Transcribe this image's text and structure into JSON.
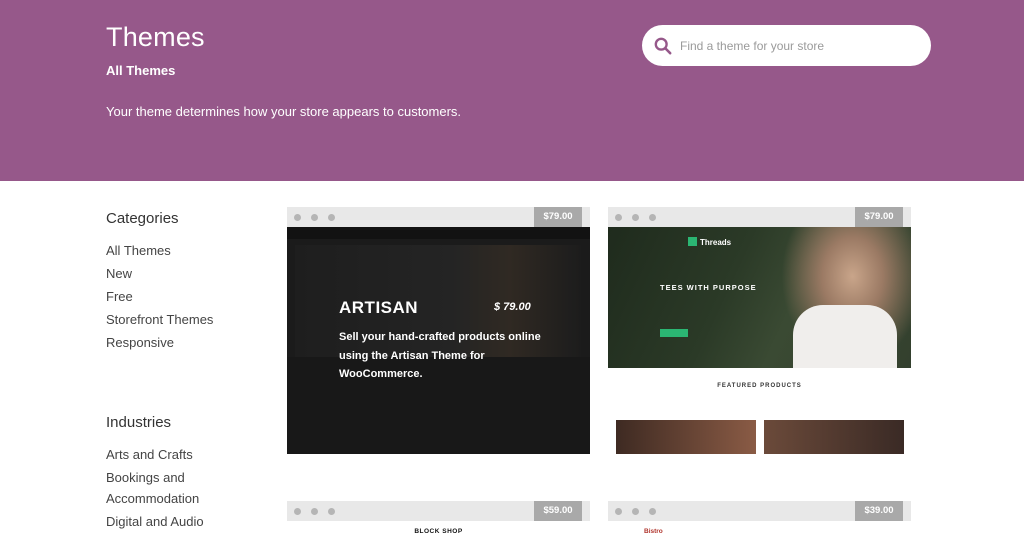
{
  "header": {
    "title": "Themes",
    "subtitle": "All Themes",
    "description": "Your theme determines how your store appears to customers.",
    "bg_color": "#96588a"
  },
  "search": {
    "placeholder": "Find a theme for your store",
    "icon": "search-icon"
  },
  "sidebar": {
    "categories_heading": "Categories",
    "categories": [
      "All Themes",
      "New",
      "Free",
      "Storefront Themes",
      "Responsive"
    ],
    "industries_heading": "Industries",
    "industries": [
      "Arts and Crafts",
      "Bookings and",
      "Accommodation",
      "Digital and Audio"
    ]
  },
  "themes": [
    {
      "price": "$79.00",
      "overlay_name": "ARTISAN",
      "overlay_price": "$ 79.00",
      "overlay_desc": "Sell your hand-crafted products online using the Artisan Theme for WooCommerce."
    },
    {
      "price": "$79.00",
      "logo": "Threads",
      "tagline": "TEES WITH PURPOSE",
      "featured": "FEATURED PRODUCTS"
    },
    {
      "price": "$59.00",
      "title": "BLOCK SHOP"
    },
    {
      "price": "$39.00",
      "title": "Bistro"
    }
  ]
}
